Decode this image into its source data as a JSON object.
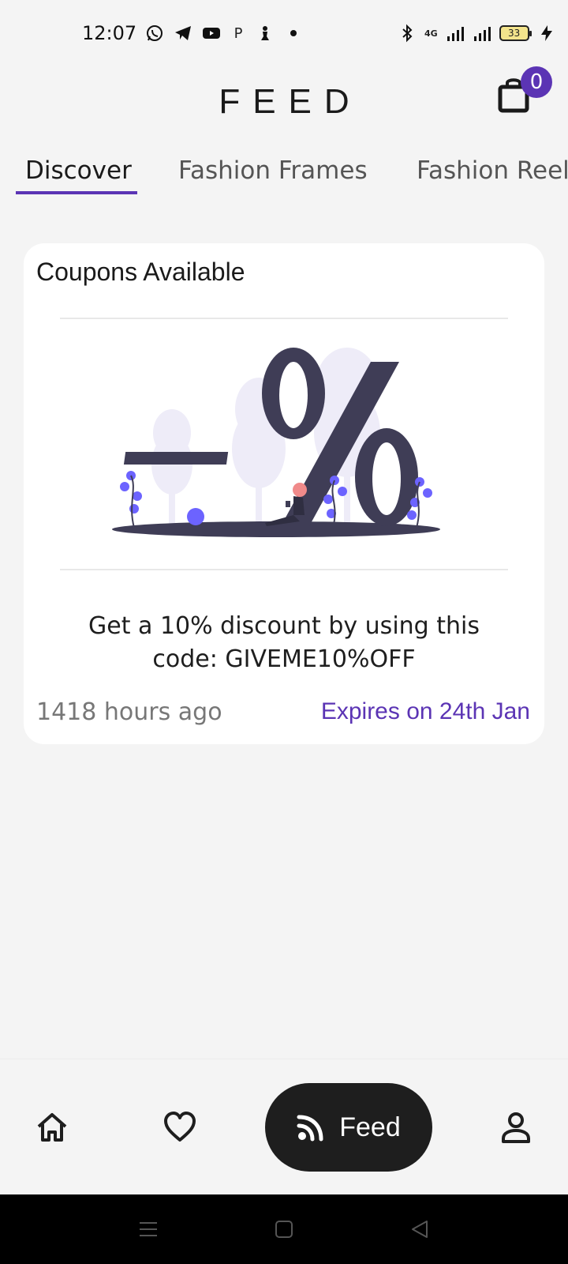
{
  "status_bar": {
    "time": "12:07",
    "left_icons": [
      "whatsapp-icon",
      "telegram-icon",
      "youtube-icon",
      "p-icon",
      "chess-pawn-icon",
      "dot-icon"
    ],
    "p_label": "P",
    "network_label": "4G",
    "battery_level": "33"
  },
  "header": {
    "title": "FEED",
    "cart_count": "0"
  },
  "tabs": [
    {
      "label": "Discover",
      "active": true
    },
    {
      "label": "Fashion Frames",
      "active": false
    },
    {
      "label": "Fashion Reels",
      "active": false
    }
  ],
  "card": {
    "title": "Coupons Available",
    "description": "Get a 10% discount by using this code: GIVEME10%OFF",
    "time_ago": "1418 hours ago",
    "expiry": "Expires on 24th Jan"
  },
  "bottom_nav": {
    "feed_label": "Feed",
    "items": [
      "home-icon",
      "heart-icon",
      "feed-icon",
      "profile-icon"
    ]
  },
  "colors": {
    "accent": "#5b34b4",
    "dark": "#1e1e1e",
    "background": "#f4f4f4",
    "illustration_dark": "#3f3d56",
    "illustration_light": "#eeecf8",
    "illustration_purple": "#6c63ff"
  }
}
